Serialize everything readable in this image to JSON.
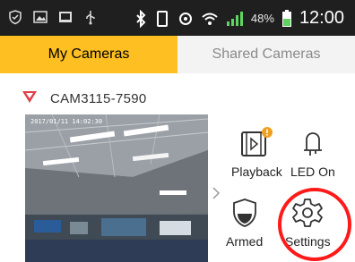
{
  "status_bar": {
    "battery_percent": "48%",
    "time": "12:00",
    "icons": [
      "shield-icon",
      "image-icon",
      "gallery-icon",
      "usb-icon",
      "bluetooth-icon",
      "vibrate-icon",
      "data-icon",
      "wifi-icon",
      "signal-icon",
      "battery-icon"
    ]
  },
  "tabs": [
    {
      "label": "My Cameras",
      "active": true
    },
    {
      "label": "Shared Cameras",
      "active": false
    }
  ],
  "camera": {
    "name": "CAM3115-7590",
    "timestamp": "2017/01/11 14:02:30"
  },
  "controls": {
    "playback_label": "Playback",
    "led_label": "LED On",
    "armed_label": "Armed",
    "settings_label": "Settings"
  },
  "colors": {
    "accent": "#fdbf22",
    "status_bar": "#1f1f1f",
    "highlight": "#ff1a1a",
    "camera_icon": "#e0404a",
    "badge": "#f0a020"
  }
}
